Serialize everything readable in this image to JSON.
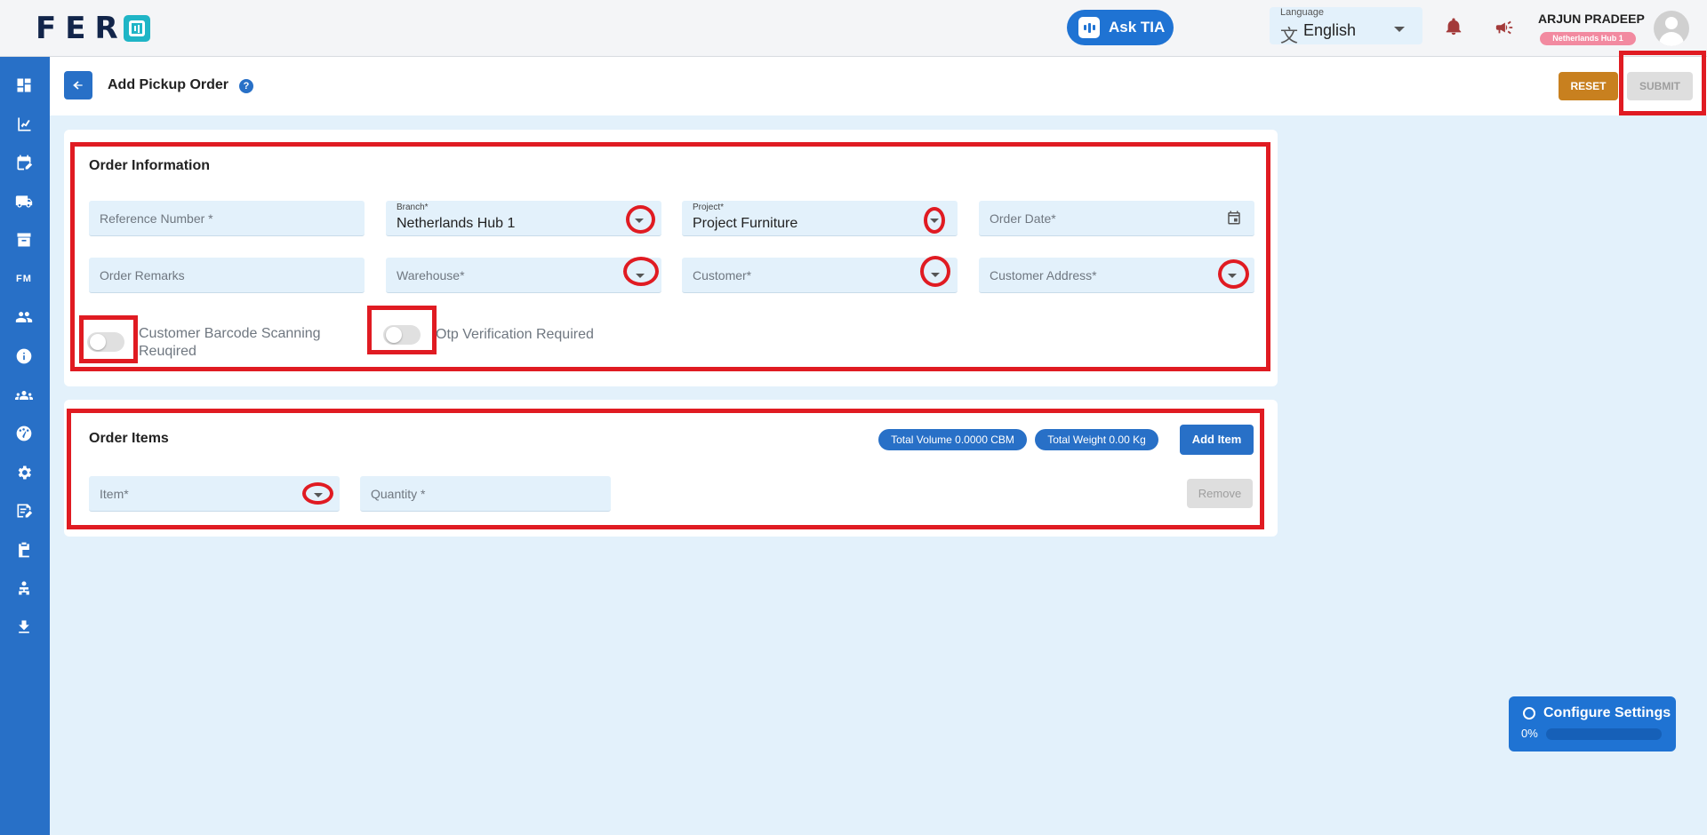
{
  "app": {
    "logo_text": "FER"
  },
  "header": {
    "ask_tia": "Ask TIA",
    "language_label": "Language",
    "language_value": "English",
    "user_name": "ARJUN PRADEEP",
    "user_branch_badge": "Netherlands Hub 1"
  },
  "sidebar": {
    "items": [
      "dashboard-icon",
      "analytics-icon",
      "edit-calendar-icon",
      "truck-icon",
      "archive-icon",
      "fm-icon",
      "users-icon",
      "info-icon",
      "groups-icon",
      "dashboard-gauge-icon",
      "settings-icon",
      "edit-note-icon",
      "clipboard-icon",
      "person-tree-icon",
      "download-icon"
    ],
    "fm_label": "FM"
  },
  "page": {
    "title": "Add Pickup Order",
    "reset_label": "RESET",
    "submit_label": "SUBMIT"
  },
  "order_information": {
    "title": "Order Information",
    "reference_number": {
      "placeholder": "Reference Number *"
    },
    "branch": {
      "label": "Branch*",
      "value": "Netherlands Hub 1"
    },
    "project": {
      "label": "Project*",
      "value": "Project Furniture"
    },
    "order_date": {
      "placeholder": "Order Date*"
    },
    "order_remarks": {
      "placeholder": "Order Remarks"
    },
    "warehouse": {
      "placeholder": "Warehouse*"
    },
    "customer": {
      "placeholder": "Customer*"
    },
    "customer_address": {
      "placeholder": "Customer Address*"
    },
    "barcode_toggle": {
      "label": "Customer Barcode Scanning Reuqired",
      "on": false
    },
    "otp_toggle": {
      "label": "Otp Verification Required",
      "on": false
    }
  },
  "order_items": {
    "title": "Order Items",
    "total_volume": "Total Volume   0.0000 CBM",
    "total_weight": "Total Weight   0.00 Kg",
    "add_item_label": "Add Item",
    "item": {
      "placeholder": "Item*"
    },
    "quantity": {
      "placeholder": "Quantity *"
    },
    "remove_label": "Remove"
  },
  "configure_settings": {
    "title": "Configure Settings",
    "progress_text": "0%",
    "progress": 0
  },
  "colors": {
    "primary": "#2870c7",
    "reset": "#c8801f",
    "highlight": "#e01b22",
    "background": "#e3f1fb"
  }
}
